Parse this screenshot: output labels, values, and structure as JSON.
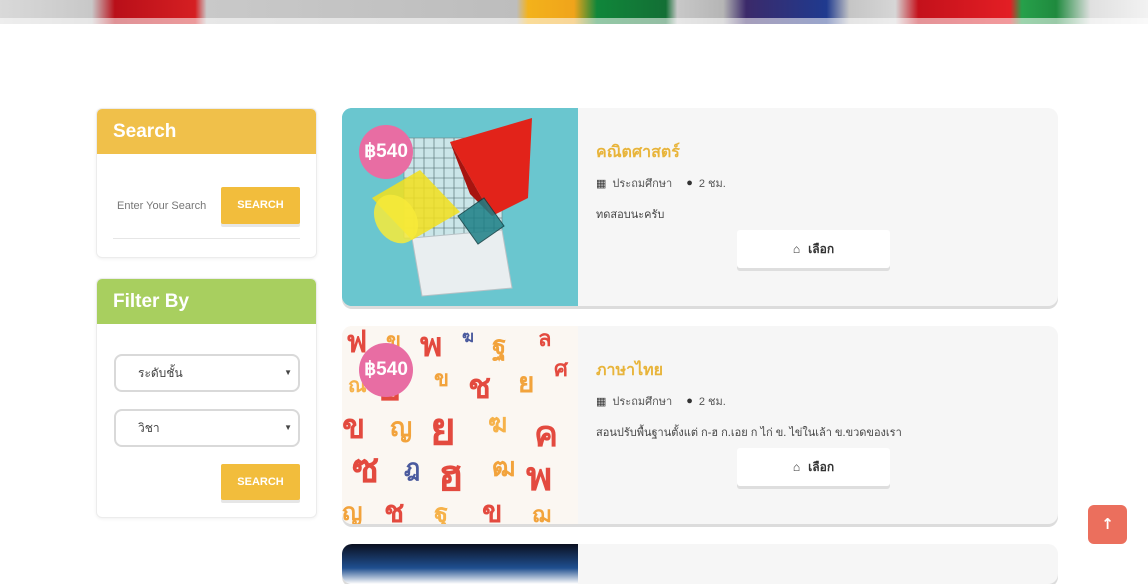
{
  "search": {
    "title": "Search",
    "placeholder": "Enter Your Search",
    "button": "SEARCH"
  },
  "filter": {
    "title": "Filter By",
    "level_selected": "ระดับชั้น",
    "subject_selected": "วิชา",
    "button": "SEARCH"
  },
  "courses": [
    {
      "price": "฿540",
      "title": "คณิตศาสตร์",
      "level": "ประถมศึกษา",
      "duration": "2 ชม.",
      "description": "ทดสอบนะครับ",
      "select_label": "เลือก"
    },
    {
      "price": "฿540",
      "title": "ภาษาไทย",
      "level": "ประถมศึกษา",
      "duration": "2 ชม.",
      "description": "สอนปรับพื้นฐานตั้งแต่ ก-ฮ ก.เอย ก ไก่ ข. ไข่ในเล้า ข.ขวดของเรา",
      "select_label": "เลือก"
    }
  ],
  "icons": {
    "calendar": "calendar-icon",
    "clock": "clock-icon",
    "basket": "basket-icon",
    "back_to_top": "arrow-up-icon"
  },
  "colors": {
    "search_header": "#f0c04a",
    "filter_header": "#a8cf5f",
    "button": "#f2bd3c",
    "price_badge": "#e86da3",
    "course_title": "#e8b43a",
    "back_to_top": "#eb6f5d"
  }
}
